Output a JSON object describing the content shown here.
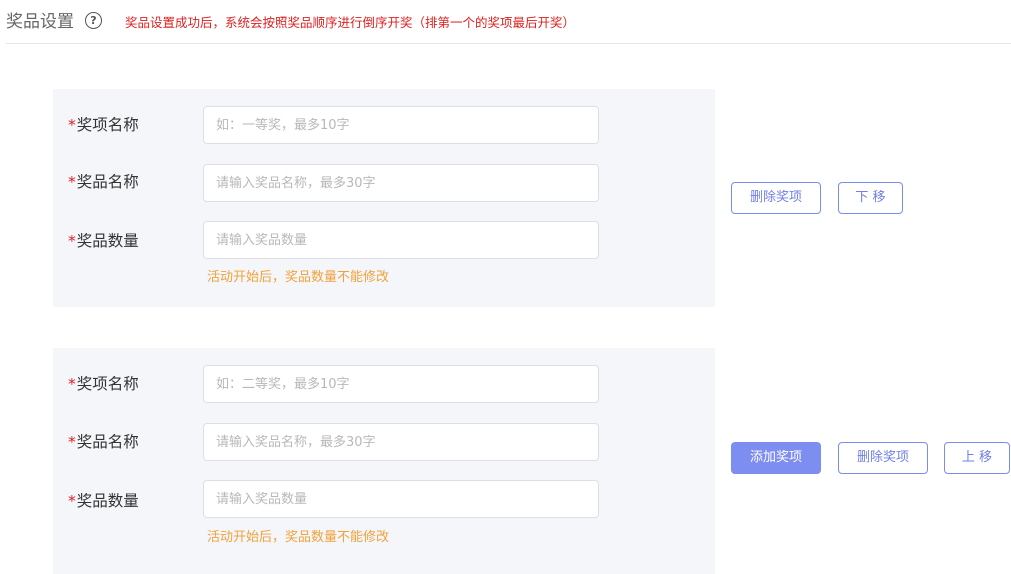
{
  "header": {
    "title": "奖品设置",
    "help_glyph": "?",
    "notice": "奖品设置成功后，系统会按照奖品顺序进行倒序开奖（排第一个的奖项最后开奖）"
  },
  "prizes": [
    {
      "fields": [
        {
          "required_mark": "*",
          "label": "奖项名称",
          "value": "",
          "placeholder": "如：一等奖，最多10字"
        },
        {
          "required_mark": "*",
          "label": "奖品名称",
          "value": "",
          "placeholder": "请输入奖品名称，最多30字"
        },
        {
          "required_mark": "*",
          "label": "奖品数量",
          "value": "",
          "placeholder": "请输入奖品数量"
        }
      ],
      "hint": "活动开始后，奖品数量不能修改",
      "buttons": [
        "删除奖项",
        "下 移"
      ]
    },
    {
      "fields": [
        {
          "required_mark": "*",
          "label": "奖项名称",
          "value": "",
          "placeholder": "如：二等奖，最多10字"
        },
        {
          "required_mark": "*",
          "label": "奖品名称",
          "value": "",
          "placeholder": "请输入奖品名称，最多30字"
        },
        {
          "required_mark": "*",
          "label": "奖品数量",
          "value": "",
          "placeholder": "请输入奖品数量"
        }
      ],
      "hint": "活动开始后，奖品数量不能修改",
      "buttons": [
        "添加奖项",
        "删除奖项",
        "上 移"
      ]
    }
  ],
  "colors": {
    "accent": "#7e8df0",
    "required": "#e02020",
    "hint": "#f0a23b",
    "card_bg": "#f5f6fa"
  }
}
